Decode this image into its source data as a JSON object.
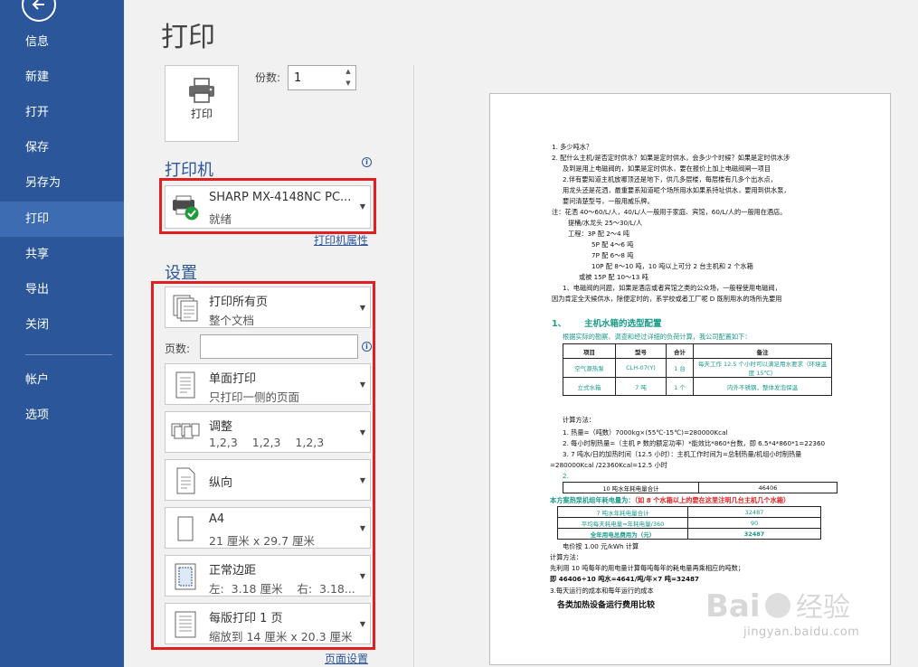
{
  "sidebar": {
    "items": [
      {
        "label": "信息"
      },
      {
        "label": "新建"
      },
      {
        "label": "打开"
      },
      {
        "label": "保存"
      },
      {
        "label": "另存为"
      },
      {
        "label": "打印"
      },
      {
        "label": "共享"
      },
      {
        "label": "导出"
      },
      {
        "label": "关闭"
      },
      {
        "label": "帐户"
      },
      {
        "label": "选项"
      }
    ],
    "active": "打印",
    "accent_color": "#2b579a"
  },
  "page_title": "打印",
  "print_button": {
    "label": "打印",
    "icon": "printer-icon"
  },
  "copies": {
    "label": "份数:",
    "value": "1"
  },
  "printer": {
    "section_title": "打印机",
    "name": "SHARP MX-4148NC PC...",
    "status": "就绪",
    "properties_link": "打印机属性"
  },
  "settings": {
    "section_title": "设置",
    "print_range": {
      "main": "打印所有页",
      "sub": "整个文档"
    },
    "pages": {
      "label": "页数:",
      "value": ""
    },
    "sides": {
      "main": "单面打印",
      "sub": "只打印一侧的页面"
    },
    "collate": {
      "main": "调整",
      "sub": "1,2,3    1,2,3    1,2,3"
    },
    "orientation": {
      "main": "纵向"
    },
    "paper": {
      "main": "A4",
      "sub": "21 厘米 x 29.7 厘米"
    },
    "margins": {
      "main": "正常边距",
      "sub": "左:  3.18 厘米    右:  3.18..."
    },
    "per_sheet": {
      "main": "每版打印 1 页",
      "sub": "缩放到 14 厘米 x 20.3 厘米"
    },
    "page_setup_link": "页面设置"
  },
  "preview": {
    "lines": [
      "1.   多少吨水？",
      "2.   配什么主机/是否定时供水？如果是定时供水，会多少个时候？如果是定时供水涉",
      "及到是用上电磁阀的，如果是定时供水，要在报价上加上电磁阀闸一项目",
      "2.伴有要知道主机放哪顶还是地下，供几多层楼，每层楼有几多个出水点，",
      "用龙头还是花洒，最重要系知道呢个场所用水如果系持址供水，要用到供水泵，",
      "要问清楚型号，一般用威乐牌。",
      "注：花洒 40～60/L/人，40/L/人一般用于家庭、宾馆，60/L/人的一般用在酒店。",
      "提桶/水龙头 25～30/L/人",
      "工程：3P 配 2～4 吨",
      "5P 配 4～6 吨",
      "7P 配 6～8 吨",
      "10P 配 8～10 吨，10 吨以上可分 2 台主机和 2 个水箱",
      "或被    15P 配 10～13 吨",
      "1、电磁阀的问题，如果是酒店或者宾馆之类的公众场，一般程使用电磁阀，",
      "因为肯定全天候供水，除便定时的，系学校或者工厂呢 D 既制用水的场所先要用"
    ],
    "heading1_num": "1、",
    "heading1": "主机水箱的选型配置",
    "intro": "根据实际的勘察、调查和经过详细的负荷计算，我公司配置如下：",
    "table1": {
      "headers": [
        "项目",
        "型号",
        "合计",
        "备注"
      ],
      "rows": [
        [
          "空气源热泵",
          "CLH-07(Y)",
          "1 台",
          "每天工作 12.5 个小时可以满足用水要求（环境温度 15℃）"
        ],
        [
          "立式水箱",
          "7 吨",
          "1 个",
          "内外不锈钢，整体发泡保温"
        ]
      ]
    },
    "calc_lines": [
      "计算方法：",
      "1. 热量=（吨数）7000kg×(55℃-15℃)=280000Kcal",
      "2. 每小时制热量=（主机 P 数的额定功率）*能效比*860*台数，即 6.5*4*860*1=22360",
      "3. 7 吨水/日的加热时间（12.5 小时）：主机工作时间为=总制热量/机组小时制热量",
      "=280000Kcal /22360Kcal=12.5 小时",
      "2."
    ],
    "table2": {
      "label": "10 吨水年耗电量合计",
      "value": "46406"
    },
    "plan_line_a": "本方案热泵机组年耗电量为：",
    "plan_line_b": "（如 8 个水箱以上的要在这里注明几台主机几个水箱）",
    "table3": [
      [
        "7 吨水年耗电量合计",
        "32487"
      ],
      [
        "平均每天耗电量=年耗电量/360",
        "90"
      ],
      [
        "全年用电总费用为（元）",
        "32487"
      ]
    ],
    "tail_lines": [
      "电价按 1.00 元/kWh 计算",
      "计算方法：",
      "先利用 10 吨每年的用电量计算每吨每年的耗电量再乘相应的吨数；",
      "即 46406÷10 吨水=4641/吨/年×7 吨=32487",
      "3.每天运行的成本和每年运行的成本"
    ],
    "footer_title": "各类加热设备运行费用比较"
  },
  "watermark": {
    "brand": "Bai 经验",
    "url": "jingyan.baidu.com"
  },
  "colors": {
    "highlight_box": "#e02020",
    "preview_teal": "#1a9a8a"
  }
}
